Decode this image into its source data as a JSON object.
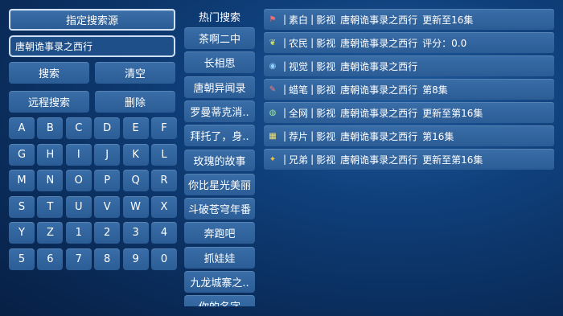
{
  "left": {
    "source_button": "指定搜索源",
    "search_input_value": "唐朝诡事录之西行",
    "search_button": "搜索",
    "clear_button": "清空",
    "remote_search_button": "远程搜索",
    "delete_button": "删除"
  },
  "keyboard": {
    "keys": [
      "A",
      "B",
      "C",
      "D",
      "E",
      "F",
      "G",
      "H",
      "I",
      "J",
      "K",
      "L",
      "M",
      "N",
      "O",
      "P",
      "Q",
      "R",
      "S",
      "T",
      "U",
      "V",
      "W",
      "X",
      "Y",
      "Z",
      "1",
      "2",
      "3",
      "4",
      "5",
      "6",
      "7",
      "8",
      "9",
      "0"
    ]
  },
  "hot": {
    "title": "热门搜索",
    "items": [
      "茶啊二中",
      "长相思",
      "唐朝异闻录",
      "罗曼蒂克消..",
      "拜托了，身..",
      "玫瑰的故事",
      "你比星光美丽",
      "斗破苍穹年番",
      "奔跑吧",
      "抓娃娃",
      "九龙城寨之..",
      "你的名字"
    ]
  },
  "results": [
    {
      "icon": "flag-icon",
      "source": "素白",
      "category": "影视",
      "title": "唐朝诡事录之西行",
      "extra": "更新至16集"
    },
    {
      "icon": "leaf-icon",
      "source": "农民",
      "category": "影视",
      "title": "唐朝诡事录之西行",
      "extra": "评分：0.0"
    },
    {
      "icon": "eye-icon",
      "source": "视觉",
      "category": "影视",
      "title": "唐朝诡事录之西行",
      "extra": ""
    },
    {
      "icon": "crayon-icon",
      "source": "蜡笔",
      "category": "影视",
      "title": "唐朝诡事录之西行",
      "extra": "第8集"
    },
    {
      "icon": "globe-icon",
      "source": "全网",
      "category": "影视",
      "title": "唐朝诡事录之西行",
      "extra": "更新至第16集"
    },
    {
      "icon": "film-icon",
      "source": "荐片",
      "category": "影视",
      "title": "唐朝诡事录之西行",
      "extra": "第16集"
    },
    {
      "icon": "group-icon",
      "source": "兄弟",
      "category": "影视",
      "title": "唐朝诡事录之西行",
      "extra": "更新至第16集"
    }
  ],
  "colors": {
    "button_bg": "#2f62a0",
    "focus_border": "#cfe0f5"
  }
}
